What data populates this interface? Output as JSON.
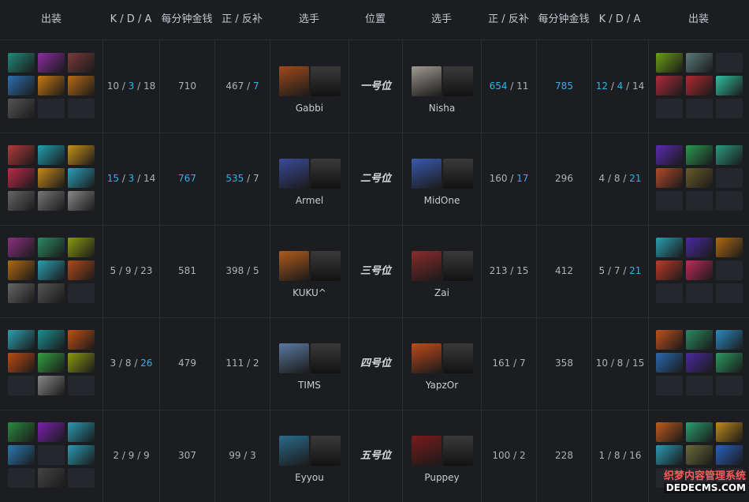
{
  "header": {
    "items_left": "出装",
    "kda": "K / D / A",
    "gpm": "每分钟金钱",
    "lh_dn": "正 / 反补",
    "player_left": "选手",
    "position": "位置",
    "player_right": "选手",
    "lh_dn_right": "正 / 反补",
    "gpm_right": "每分钟金钱",
    "kda_right": "K / D / A",
    "items_right": "出装"
  },
  "rows": [
    {
      "position": "一号位",
      "left": {
        "player": "Gabbi",
        "k": "10",
        "d": "3",
        "a": "18",
        "gpm": "710",
        "lh": "467",
        "dn": "7"
      },
      "right": {
        "player": "Nisha",
        "k": "12",
        "d": "4",
        "a": "14",
        "gpm": "785",
        "lh": "654",
        "dn": "11"
      }
    },
    {
      "position": "二号位",
      "left": {
        "player": "Armel",
        "k": "15",
        "d": "3",
        "a": "14",
        "gpm": "767",
        "lh": "535",
        "dn": "7"
      },
      "right": {
        "player": "MidOne",
        "k": "4",
        "d": "8",
        "a": "21",
        "gpm": "296",
        "lh": "160",
        "dn": "17"
      }
    },
    {
      "position": "三号位",
      "left": {
        "player": "KUKU^",
        "k": "5",
        "d": "9",
        "a": "23",
        "gpm": "581",
        "lh": "398",
        "dn": "5"
      },
      "right": {
        "player": "Zai",
        "k": "5",
        "d": "7",
        "a": "21",
        "gpm": "412",
        "lh": "213",
        "dn": "15"
      }
    },
    {
      "position": "四号位",
      "left": {
        "player": "TIMS",
        "k": "3",
        "d": "8",
        "a": "26",
        "gpm": "479",
        "lh": "111",
        "dn": "2"
      },
      "right": {
        "player": "YapzOr",
        "k": "10",
        "d": "8",
        "a": "15",
        "gpm": "358",
        "lh": "161",
        "dn": "7"
      }
    },
    {
      "position": "五号位",
      "left": {
        "player": "Eyyou",
        "k": "2",
        "d": "9",
        "a": "9",
        "gpm": "307",
        "lh": "99",
        "dn": "3"
      },
      "right": {
        "player": "Puppey",
        "k": "1",
        "d": "8",
        "a": "16",
        "gpm": "228",
        "lh": "100",
        "dn": "2"
      }
    }
  ],
  "watermark": {
    "line1": "织梦内容管理系统",
    "line2": "DEDECMS.COM"
  },
  "colors": {
    "highlight": "#2fb3e6",
    "background": "#1c1d21",
    "grid": "#2b2d33"
  }
}
